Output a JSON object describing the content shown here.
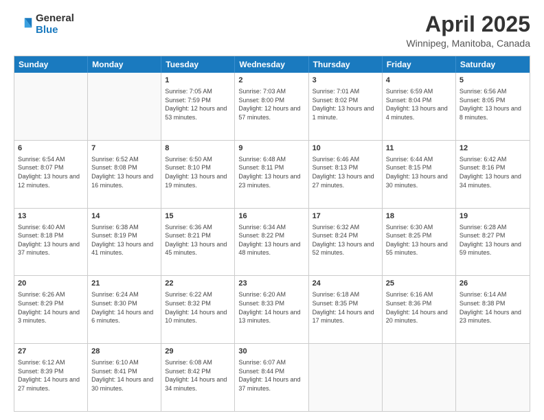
{
  "logo": {
    "line1": "General",
    "line2": "Blue"
  },
  "title": "April 2025",
  "subtitle": "Winnipeg, Manitoba, Canada",
  "days_of_week": [
    "Sunday",
    "Monday",
    "Tuesday",
    "Wednesday",
    "Thursday",
    "Friday",
    "Saturday"
  ],
  "weeks": [
    [
      {
        "day": "",
        "empty": true
      },
      {
        "day": "",
        "empty": true
      },
      {
        "day": "1",
        "sunrise": "Sunrise: 7:05 AM",
        "sunset": "Sunset: 7:59 PM",
        "daylight": "Daylight: 12 hours and 53 minutes."
      },
      {
        "day": "2",
        "sunrise": "Sunrise: 7:03 AM",
        "sunset": "Sunset: 8:00 PM",
        "daylight": "Daylight: 12 hours and 57 minutes."
      },
      {
        "day": "3",
        "sunrise": "Sunrise: 7:01 AM",
        "sunset": "Sunset: 8:02 PM",
        "daylight": "Daylight: 13 hours and 1 minute."
      },
      {
        "day": "4",
        "sunrise": "Sunrise: 6:59 AM",
        "sunset": "Sunset: 8:04 PM",
        "daylight": "Daylight: 13 hours and 4 minutes."
      },
      {
        "day": "5",
        "sunrise": "Sunrise: 6:56 AM",
        "sunset": "Sunset: 8:05 PM",
        "daylight": "Daylight: 13 hours and 8 minutes."
      }
    ],
    [
      {
        "day": "6",
        "sunrise": "Sunrise: 6:54 AM",
        "sunset": "Sunset: 8:07 PM",
        "daylight": "Daylight: 13 hours and 12 minutes."
      },
      {
        "day": "7",
        "sunrise": "Sunrise: 6:52 AM",
        "sunset": "Sunset: 8:08 PM",
        "daylight": "Daylight: 13 hours and 16 minutes."
      },
      {
        "day": "8",
        "sunrise": "Sunrise: 6:50 AM",
        "sunset": "Sunset: 8:10 PM",
        "daylight": "Daylight: 13 hours and 19 minutes."
      },
      {
        "day": "9",
        "sunrise": "Sunrise: 6:48 AM",
        "sunset": "Sunset: 8:11 PM",
        "daylight": "Daylight: 13 hours and 23 minutes."
      },
      {
        "day": "10",
        "sunrise": "Sunrise: 6:46 AM",
        "sunset": "Sunset: 8:13 PM",
        "daylight": "Daylight: 13 hours and 27 minutes."
      },
      {
        "day": "11",
        "sunrise": "Sunrise: 6:44 AM",
        "sunset": "Sunset: 8:15 PM",
        "daylight": "Daylight: 13 hours and 30 minutes."
      },
      {
        "day": "12",
        "sunrise": "Sunrise: 6:42 AM",
        "sunset": "Sunset: 8:16 PM",
        "daylight": "Daylight: 13 hours and 34 minutes."
      }
    ],
    [
      {
        "day": "13",
        "sunrise": "Sunrise: 6:40 AM",
        "sunset": "Sunset: 8:18 PM",
        "daylight": "Daylight: 13 hours and 37 minutes."
      },
      {
        "day": "14",
        "sunrise": "Sunrise: 6:38 AM",
        "sunset": "Sunset: 8:19 PM",
        "daylight": "Daylight: 13 hours and 41 minutes."
      },
      {
        "day": "15",
        "sunrise": "Sunrise: 6:36 AM",
        "sunset": "Sunset: 8:21 PM",
        "daylight": "Daylight: 13 hours and 45 minutes."
      },
      {
        "day": "16",
        "sunrise": "Sunrise: 6:34 AM",
        "sunset": "Sunset: 8:22 PM",
        "daylight": "Daylight: 13 hours and 48 minutes."
      },
      {
        "day": "17",
        "sunrise": "Sunrise: 6:32 AM",
        "sunset": "Sunset: 8:24 PM",
        "daylight": "Daylight: 13 hours and 52 minutes."
      },
      {
        "day": "18",
        "sunrise": "Sunrise: 6:30 AM",
        "sunset": "Sunset: 8:25 PM",
        "daylight": "Daylight: 13 hours and 55 minutes."
      },
      {
        "day": "19",
        "sunrise": "Sunrise: 6:28 AM",
        "sunset": "Sunset: 8:27 PM",
        "daylight": "Daylight: 13 hours and 59 minutes."
      }
    ],
    [
      {
        "day": "20",
        "sunrise": "Sunrise: 6:26 AM",
        "sunset": "Sunset: 8:29 PM",
        "daylight": "Daylight: 14 hours and 3 minutes."
      },
      {
        "day": "21",
        "sunrise": "Sunrise: 6:24 AM",
        "sunset": "Sunset: 8:30 PM",
        "daylight": "Daylight: 14 hours and 6 minutes."
      },
      {
        "day": "22",
        "sunrise": "Sunrise: 6:22 AM",
        "sunset": "Sunset: 8:32 PM",
        "daylight": "Daylight: 14 hours and 10 minutes."
      },
      {
        "day": "23",
        "sunrise": "Sunrise: 6:20 AM",
        "sunset": "Sunset: 8:33 PM",
        "daylight": "Daylight: 14 hours and 13 minutes."
      },
      {
        "day": "24",
        "sunrise": "Sunrise: 6:18 AM",
        "sunset": "Sunset: 8:35 PM",
        "daylight": "Daylight: 14 hours and 17 minutes."
      },
      {
        "day": "25",
        "sunrise": "Sunrise: 6:16 AM",
        "sunset": "Sunset: 8:36 PM",
        "daylight": "Daylight: 14 hours and 20 minutes."
      },
      {
        "day": "26",
        "sunrise": "Sunrise: 6:14 AM",
        "sunset": "Sunset: 8:38 PM",
        "daylight": "Daylight: 14 hours and 23 minutes."
      }
    ],
    [
      {
        "day": "27",
        "sunrise": "Sunrise: 6:12 AM",
        "sunset": "Sunset: 8:39 PM",
        "daylight": "Daylight: 14 hours and 27 minutes."
      },
      {
        "day": "28",
        "sunrise": "Sunrise: 6:10 AM",
        "sunset": "Sunset: 8:41 PM",
        "daylight": "Daylight: 14 hours and 30 minutes."
      },
      {
        "day": "29",
        "sunrise": "Sunrise: 6:08 AM",
        "sunset": "Sunset: 8:42 PM",
        "daylight": "Daylight: 14 hours and 34 minutes."
      },
      {
        "day": "30",
        "sunrise": "Sunrise: 6:07 AM",
        "sunset": "Sunset: 8:44 PM",
        "daylight": "Daylight: 14 hours and 37 minutes."
      },
      {
        "day": "",
        "empty": true
      },
      {
        "day": "",
        "empty": true
      },
      {
        "day": "",
        "empty": true
      }
    ]
  ]
}
